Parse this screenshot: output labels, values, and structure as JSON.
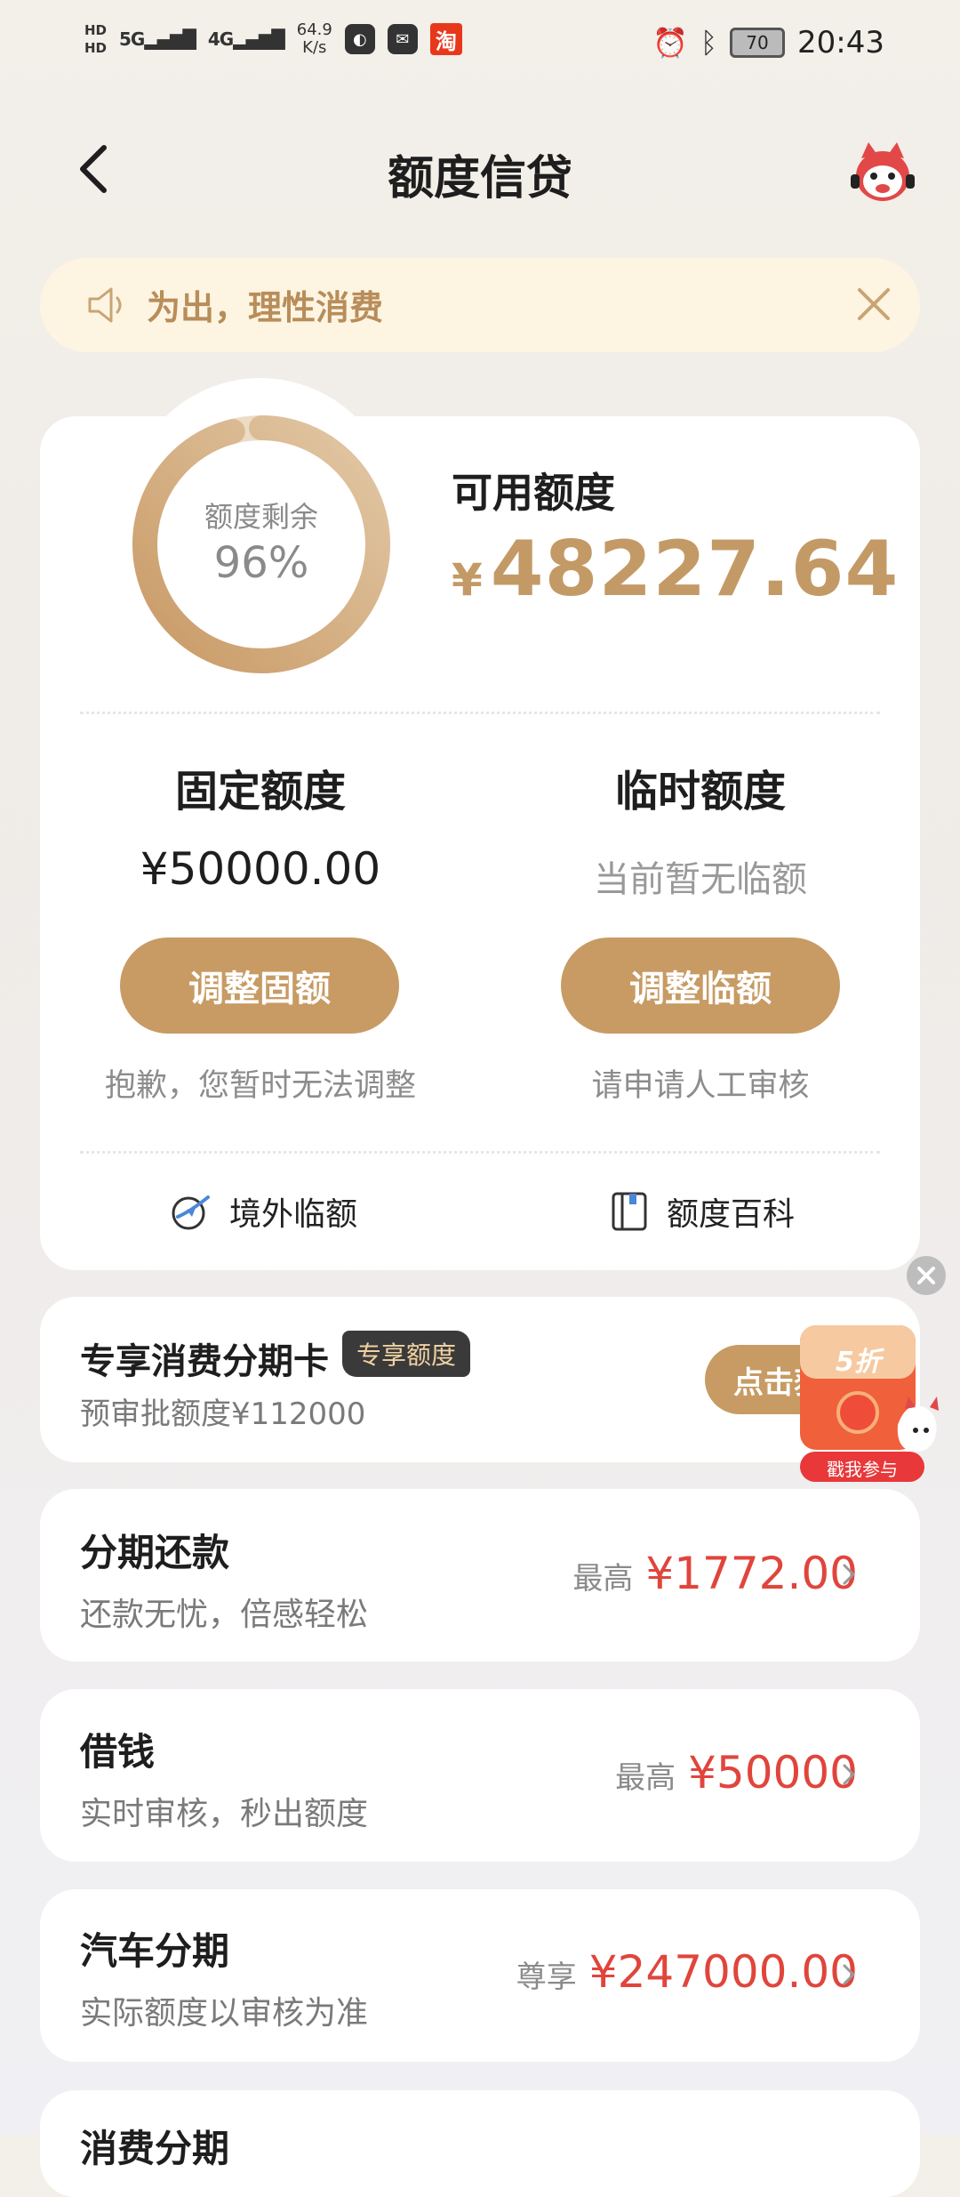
{
  "status_bar": {
    "hd1": "HD",
    "hd2": "HD",
    "signal1": "5G",
    "signal2": "4G",
    "speed_value": "64.9",
    "speed_unit": "K/s",
    "taobao": "淘",
    "battery": "70",
    "time": "20:43"
  },
  "nav": {
    "title": "额度信贷"
  },
  "notice": {
    "text": "为出，理性消费"
  },
  "credit": {
    "ring_label": "额度剩余",
    "ring_value": "96%",
    "ring_fraction": 0.96,
    "available_label": "可用额度",
    "currency": "¥",
    "available_amount": "48227.64",
    "fixed": {
      "title": "固定额度",
      "value": "¥50000.00",
      "button": "调整固额",
      "hint": "抱歉，您暂时无法调整"
    },
    "temporary": {
      "title": "临时额度",
      "value": "当前暂无临额",
      "button": "调整临额",
      "hint": "请申请人工审核"
    },
    "links": {
      "overseas": "境外临额",
      "wiki": "额度百科"
    }
  },
  "installment_card": {
    "title": "专享消费分期卡",
    "badge": "专享额度",
    "subtitle": "预审批额度¥112000",
    "button": "点击获"
  },
  "promo": {
    "discount": "5折",
    "button": "戳我参与"
  },
  "rows": [
    {
      "title": "分期还款",
      "subtitle": "还款无忧，倍感轻松",
      "prefix": "最高",
      "amount": "¥1772.00"
    },
    {
      "title": "借钱",
      "subtitle": "实时审核，秒出额度",
      "prefix": "最高",
      "amount": "¥50000"
    },
    {
      "title": "汽车分期",
      "subtitle": "实际额度以审核为准",
      "prefix": "尊享",
      "amount": "¥247000.00"
    },
    {
      "title": "消费分期",
      "subtitle": "",
      "prefix": "",
      "amount": ""
    }
  ],
  "colors": {
    "accent": "#c79b63",
    "amount_red": "#e0453c",
    "notice_bg": "#fdf5e2"
  }
}
